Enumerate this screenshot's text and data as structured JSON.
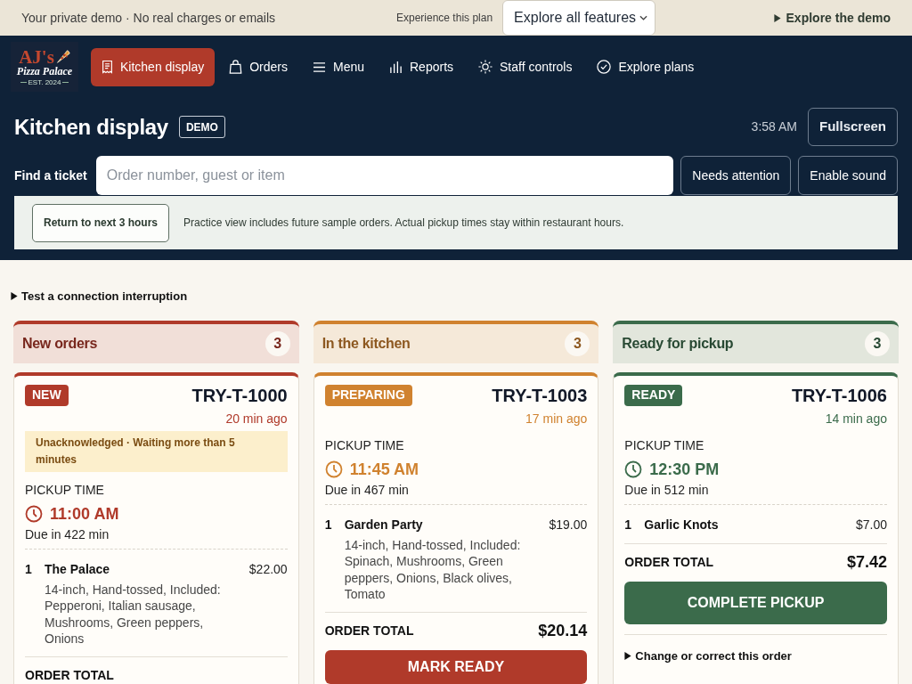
{
  "demo_bar": {
    "notice": "Your private demo · No real charges or emails",
    "plan_label": "Experience this plan",
    "plan_select": {
      "value": "Explore all features"
    },
    "demo_toggle": "Explore the demo"
  },
  "nav": {
    "logo": {
      "name": "AJ's",
      "subtitle": "Pizza Palace",
      "tagline": "EST. 2024"
    },
    "items": [
      {
        "label": "Kitchen display",
        "selected": true
      },
      {
        "label": "Orders",
        "selected": false
      },
      {
        "label": "Menu",
        "selected": false
      },
      {
        "label": "Reports",
        "selected": false
      },
      {
        "label": "Staff controls",
        "selected": false
      },
      {
        "label": "Explore plans",
        "selected": false
      }
    ]
  },
  "header": {
    "title": "Kitchen display",
    "badge": "DEMO",
    "clock": "3:58 AM",
    "fullscreen_button": "Fullscreen"
  },
  "search": {
    "label": "Find a ticket",
    "placeholder": "Order number, guest or item",
    "buttons": [
      "Needs attention",
      "Enable sound"
    ]
  },
  "practice_banner": {
    "button": "Return to next 3 hours",
    "text": "Practice view includes future sample orders. Actual pickup times stay within restaurant hours."
  },
  "connection_toggle": "Test a connection interruption",
  "columns": [
    {
      "title": "New orders",
      "count": "3",
      "color": "#b03a2a",
      "tickets": [
        {
          "status": "NEW",
          "id": "TRY-T-1000",
          "age": "20 min ago",
          "alert": "Unacknowledged · Waiting more than 5 minutes",
          "pickup_label": "PICKUP TIME",
          "pickup_time": "11:00 AM",
          "due": "Due in 422 min",
          "items": [
            {
              "qty": "1",
              "name": "The Palace",
              "price": "$22.00",
              "details": "14-inch, Hand-tossed, Included: Pepperoni, Italian sausage, Mushrooms, Green peppers, Onions"
            }
          ],
          "total_label": "ORDER TOTAL"
        }
      ]
    },
    {
      "title": "In the kitchen",
      "count": "3",
      "color": "#d0822f",
      "tickets": [
        {
          "status": "PREPARING",
          "id": "TRY-T-1003",
          "age": "17 min ago",
          "pickup_label": "PICKUP TIME",
          "pickup_time": "11:45 AM",
          "due": "Due in 467 min",
          "items": [
            {
              "qty": "1",
              "name": "Garden Party",
              "price": "$19.00",
              "details": "14-inch, Hand-tossed, Included: Spinach, Mushrooms, Green peppers, Onions, Black olives, Tomato"
            }
          ],
          "total_label": "ORDER TOTAL",
          "total": "$20.14",
          "action": {
            "label": "MARK READY",
            "color": "#b03a2a"
          }
        }
      ]
    },
    {
      "title": "Ready for pickup",
      "count": "3",
      "color": "#3b6b4b",
      "tickets": [
        {
          "status": "READY",
          "id": "TRY-T-1006",
          "age": "14 min ago",
          "pickup_label": "PICKUP TIME",
          "pickup_time": "12:30 PM",
          "due": "Due in 512 min",
          "items": [
            {
              "qty": "1",
              "name": "Garlic Knots",
              "price": "$7.00"
            }
          ],
          "total_label": "ORDER TOTAL",
          "total": "$7.42",
          "action": {
            "label": "COMPLETE PICKUP",
            "color": "#3b6b4b"
          },
          "change_toggle": "Change or correct this order"
        }
      ]
    }
  ]
}
